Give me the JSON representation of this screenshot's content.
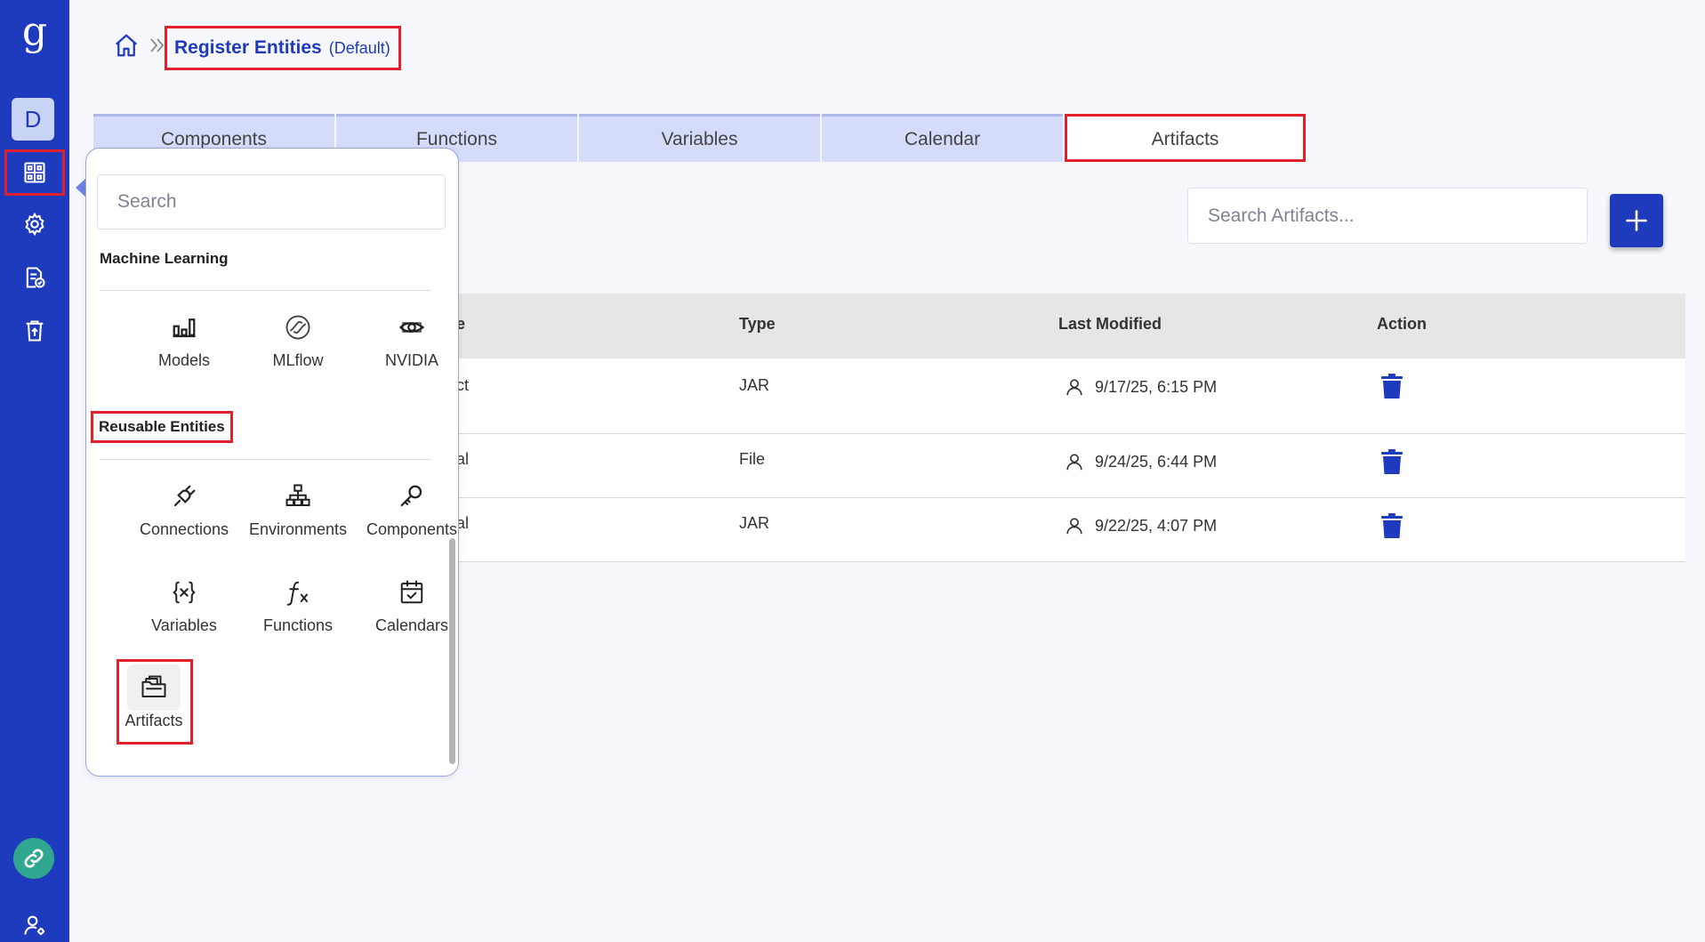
{
  "sidebar": {
    "logo": "g",
    "avatar_initial": "D",
    "colors": {
      "background": "#1e3bbd",
      "link_button": "#2fa88f"
    }
  },
  "header": {
    "title": "Register Entities",
    "subtitle": "(Default)"
  },
  "tabs": [
    {
      "label": "Components",
      "active": false
    },
    {
      "label": "Functions",
      "active": false
    },
    {
      "label": "Variables",
      "active": false
    },
    {
      "label": "Calendar",
      "active": false
    },
    {
      "label": "Artifacts",
      "active": true
    }
  ],
  "search": {
    "placeholder": "Search Artifacts..."
  },
  "table": {
    "columns": {
      "name": "e",
      "type": "Type",
      "last_modified": "Last Modified",
      "action": "Action"
    },
    "rows": [
      {
        "name": "ct",
        "type": "JAR",
        "modified": "9/17/25, 6:15 PM"
      },
      {
        "name": "al",
        "type": "File",
        "modified": "9/24/25, 6:44 PM"
      },
      {
        "name": "al",
        "type": "JAR",
        "modified": "9/22/25, 4:07 PM"
      }
    ]
  },
  "popup": {
    "search_placeholder": "Search",
    "sections": {
      "machine_learning": {
        "label": "Machine Learning",
        "items": [
          {
            "label": "Models",
            "icon": "bar-chart-icon"
          },
          {
            "label": "MLflow",
            "icon": "mlflow-icon"
          },
          {
            "label": "NVIDIA",
            "icon": "nvidia-eye-icon"
          }
        ]
      },
      "reusable": {
        "label": "Reusable Entities",
        "items": [
          {
            "label": "Connections",
            "icon": "plug-icon"
          },
          {
            "label": "Environments",
            "icon": "network-icon"
          },
          {
            "label": "Components",
            "icon": "key-icon"
          },
          {
            "label": "Variables",
            "icon": "variable-braces-icon"
          },
          {
            "label": "Functions",
            "icon": "function-icon"
          },
          {
            "label": "Calendars",
            "icon": "calendar-check-icon"
          },
          {
            "label": "Artifacts",
            "icon": "artifacts-folder-icon"
          }
        ]
      }
    }
  },
  "colors": {
    "accent": "#1e3bbd",
    "highlight": "#e0202a",
    "tab_inactive": "#d4dcfa"
  }
}
